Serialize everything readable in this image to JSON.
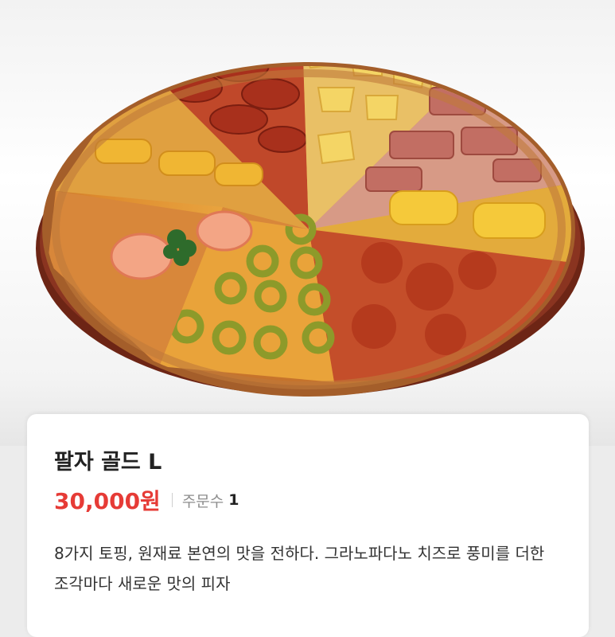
{
  "product": {
    "image_alt": "팔자 골드 L 피자 이미지",
    "name": "팔자 골드 L",
    "price": "30,000원",
    "orders_label": "주문수",
    "orders_count": "1",
    "description": "8가지 토핑, 원재료 본연의 맛을 전하다. 그라노파다노 치즈로 풍미를 더한 조각마다 새로운 맛의 피자"
  },
  "colors": {
    "price": "#e63b36",
    "title": "#222222",
    "muted": "#8d8d8d",
    "card": "#ffffff",
    "board": "#7a2a18",
    "crust": "#b36a2f"
  },
  "icons": {
    "hero": "pizza-photo"
  }
}
